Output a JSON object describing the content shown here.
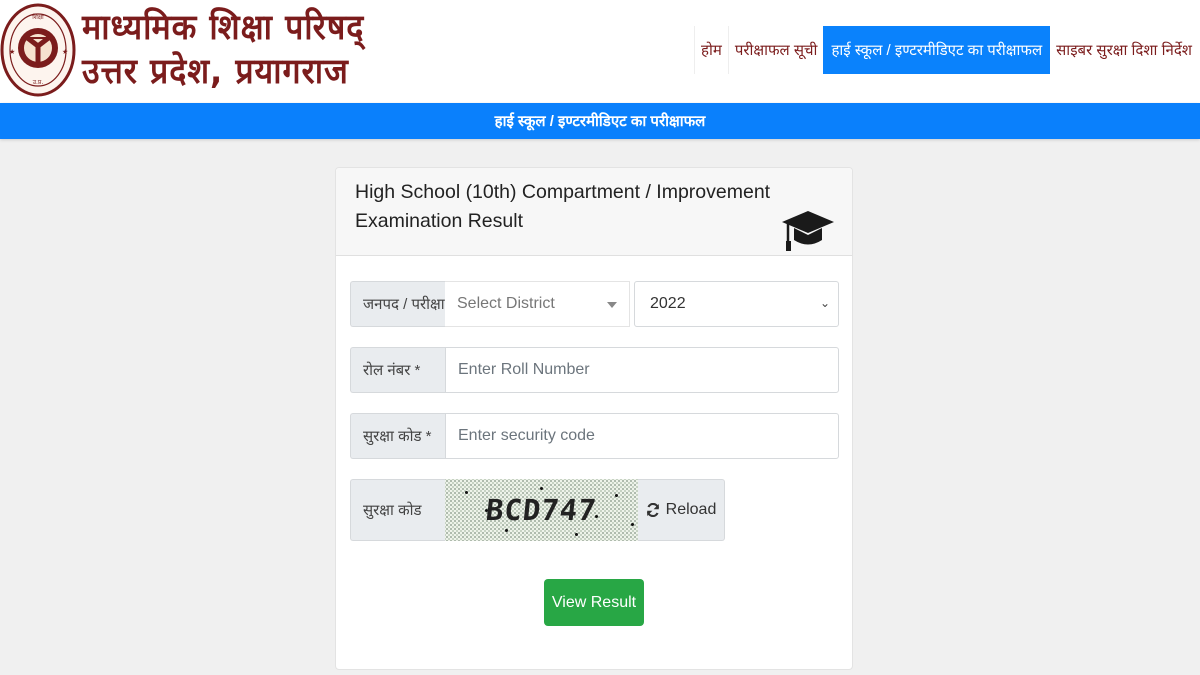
{
  "header": {
    "logo_icon": "up-board-emblem",
    "brand_line1": "माध्यमिक शिक्षा परिषद्",
    "brand_line2": "उत्तर प्रदेश, प्रयागराज",
    "nav": [
      {
        "label": "होम",
        "active": false
      },
      {
        "label": "परीक्षाफल सूची",
        "active": false
      },
      {
        "label": "हाई स्कूल / इण्टरमीडिएट का परीक्षाफल",
        "active": true
      },
      {
        "label": "साइबर सुरक्षा दिशा निर्देश",
        "active": false
      }
    ]
  },
  "title_bar": "हाई स्कूल / इण्टरमीडिएट का परीक्षाफल",
  "card": {
    "title": "High School (10th) Compartment / Improvement Examination Result",
    "icon": "graduation-cap-icon",
    "form": {
      "district_label": "जनपद / परीक्षा केंद्र",
      "district_placeholder": "Select District",
      "year_value": "2022",
      "roll_label": "रोल नंबर *",
      "roll_placeholder": "Enter Roll Number",
      "security_label": "सुरक्षा कोड *",
      "security_placeholder": "Enter security code",
      "captcha_label": "सुरक्षा कोड",
      "captcha_text": "BCD747",
      "reload_label": "Reload",
      "submit_label": "View Result"
    }
  },
  "colors": {
    "brand": "#7b1c1c",
    "primary": "#0a80fc",
    "success": "#28a745",
    "background": "#f0f0f0"
  }
}
